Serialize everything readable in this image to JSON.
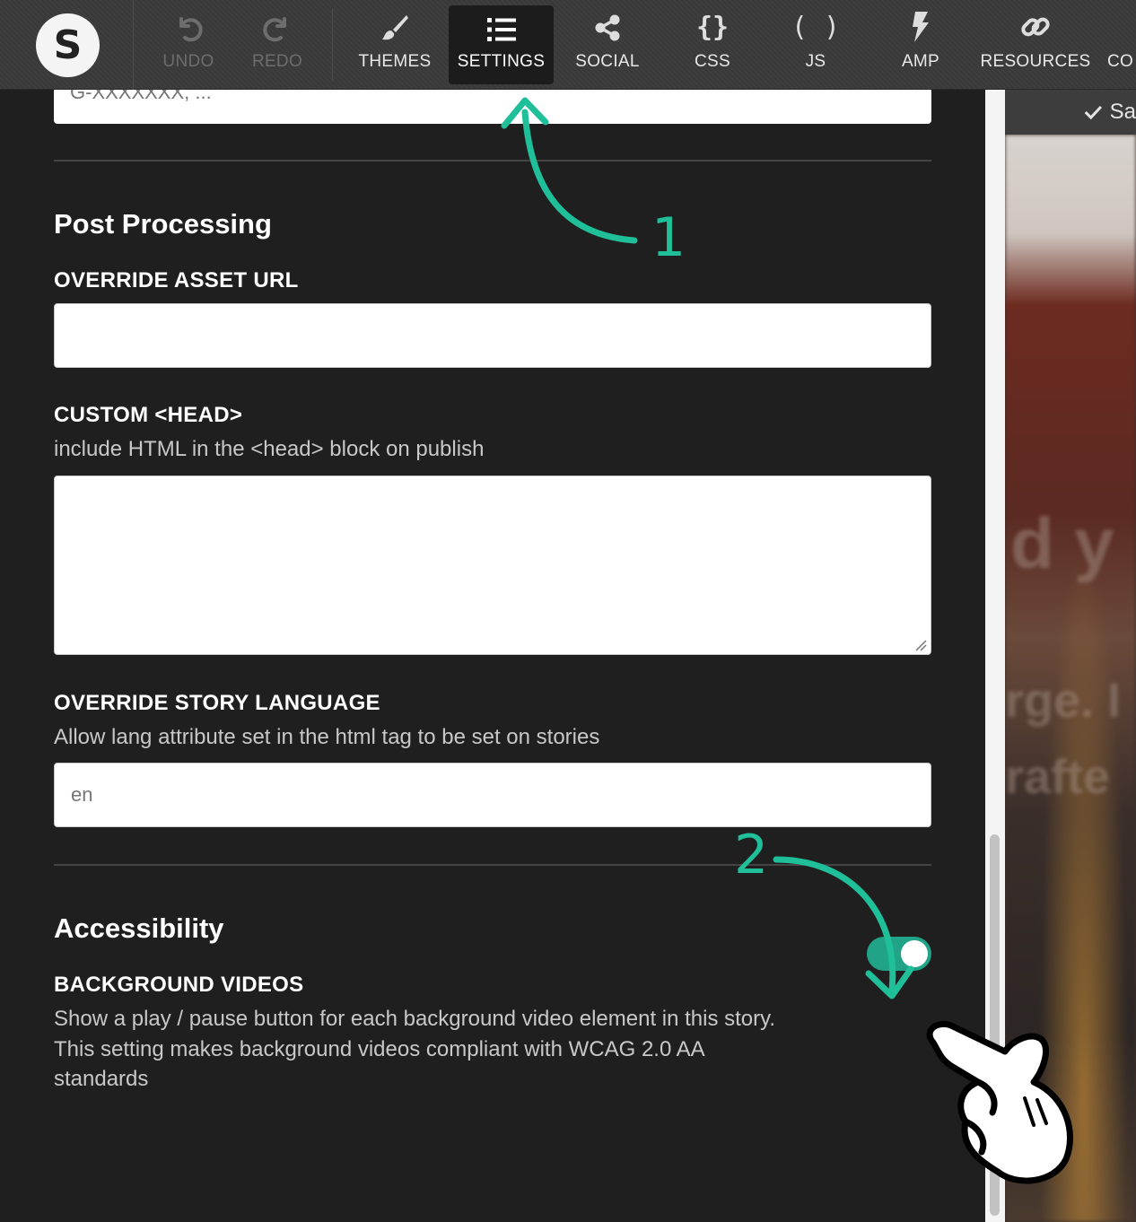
{
  "app": {
    "logo_letter": "S"
  },
  "toolbar": {
    "undo": "UNDO",
    "redo": "REDO",
    "themes": "THEMES",
    "settings": "SETTINGS",
    "social": "SOCIAL",
    "css": "CSS",
    "css_icon": "{}",
    "js": "JS",
    "js_icon": "( )",
    "amp": "AMP",
    "resources": "RESOURCES",
    "cut_item": "CO"
  },
  "settings": {
    "analytics_placeholder": "G-XXXXXXX, ...",
    "post_processing": {
      "title": "Post Processing",
      "override_asset_url_label": "OVERRIDE ASSET URL",
      "override_asset_url_value": "",
      "custom_head_label": "CUSTOM <HEAD>",
      "custom_head_desc": "include HTML in the <head> block on publish",
      "custom_head_value": "",
      "override_language_label": "OVERRIDE STORY LANGUAGE",
      "override_language_desc": "Allow lang attribute set in the html tag to be set on stories",
      "override_language_placeholder": "en"
    },
    "accessibility": {
      "title": "Accessibility",
      "background_videos_label": "BACKGROUND VIDEOS",
      "background_videos_desc_1": "Show a play / pause button for each background video element in this story.",
      "background_videos_desc_2": "This setting makes background videos compliant with WCAG 2.0 AA",
      "background_videos_desc_3": "standards",
      "background_videos_enabled": true
    }
  },
  "preview": {
    "save_status": "Sa",
    "ghost_1": "d y",
    "ghost_2": "rge. I",
    "ghost_3": "rafte"
  },
  "annotations": {
    "step_1": "1",
    "step_2": "2"
  },
  "colors": {
    "accent": "#20a386",
    "arrow": "#1fbf9a",
    "panel_bg": "#1f1f1f",
    "toolbar_bg": "#3a3a3a"
  }
}
